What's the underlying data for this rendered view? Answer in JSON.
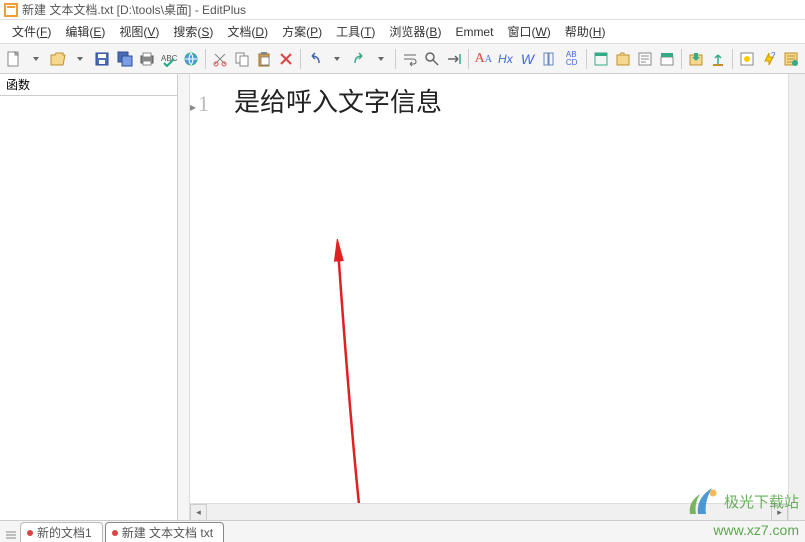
{
  "title": "新建 文本文档.txt [D:\\tools\\桌面] - EditPlus",
  "menu": {
    "file": {
      "label": "文件(",
      "key": "F",
      "suffix": ")"
    },
    "edit": {
      "label": "编辑(",
      "key": "E",
      "suffix": ")"
    },
    "view": {
      "label": "视图(",
      "key": "V",
      "suffix": ")"
    },
    "search": {
      "label": "搜索(",
      "key": "S",
      "suffix": ")"
    },
    "doc": {
      "label": "文档(",
      "key": "D",
      "suffix": ")"
    },
    "plan": {
      "label": "方案(",
      "key": "P",
      "suffix": ")"
    },
    "tool": {
      "label": "工具(",
      "key": "T",
      "suffix": ")"
    },
    "browser": {
      "label": "浏览器(",
      "key": "B",
      "suffix": ")"
    },
    "emmet": {
      "label": "Emmet"
    },
    "window": {
      "label": "窗口(",
      "key": "W",
      "suffix": ")"
    },
    "help": {
      "label": "帮助(",
      "key": "H",
      "suffix": ")"
    }
  },
  "side_tab": "函数",
  "editor": {
    "line_number": "1",
    "content": "是给呼入文字信息"
  },
  "tabs": {
    "tab1": "新的文档1",
    "tab2": "新建 文本文档 txt"
  },
  "watermark": {
    "name": "极光下载站",
    "url": "www.xz7.com"
  },
  "toolbar_text": {
    "aa": "A",
    "hx": "Hx",
    "w": "W",
    "abcd": "AB\nCD"
  }
}
